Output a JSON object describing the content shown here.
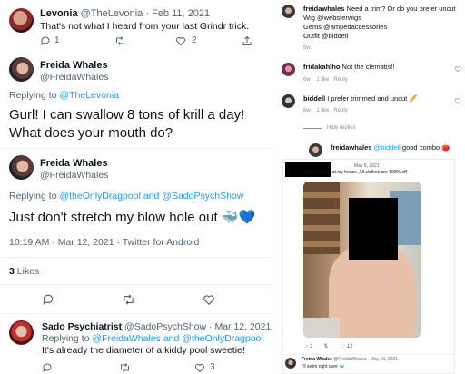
{
  "tweet1": {
    "name": "Levonia",
    "handle": "@TheLevonia",
    "dot": "·",
    "date": "Feb 11, 2021",
    "text": "That's not what I heard from your last Grindr trick.",
    "likes": "2"
  },
  "tweet2": {
    "name": "Freida Whales",
    "handle": "@FreidaWhales",
    "replying_prefix": "Replying to",
    "replying_to": "@TheLevonia",
    "text": "Gurl! I can swallow 8 tons of krill a day! What does your mouth do?"
  },
  "tweet3": {
    "name": "Freida Whales",
    "handle": "@FreidaWhales",
    "replying_prefix": "Replying to",
    "replying_to_1": "@theOnlyDragpool",
    "and": "and",
    "replying_to_2": "@SadoPsychShow",
    "text": "Just don't stretch my blow hole out",
    "emoji": "🐳💙",
    "time": "10:19 AM · Mar 12, 2021 · Twitter for Android",
    "likes_count": "3",
    "likes_label": "Likes"
  },
  "tweet4": {
    "name": "Sado Psychiatrist",
    "handle": "@SadoPsychShow",
    "dot": "·",
    "date": "Mar 12, 2021",
    "replying_prefix": "Replying to",
    "replying_to_1": "@FreidaWhales",
    "and": "and",
    "replying_to_2": "@theOnlyDragpool",
    "text": "It's already the diameter of a kiddy pool sweetie!",
    "likes": "3"
  },
  "instagram": {
    "c1_user": "freidawhales",
    "c1_text": "Need a trim? Or do you prefer uncut",
    "c1_line2": "Wig @websterwigs",
    "c1_line3": "Gems @ampedaccessories",
    "c1_line4": "Outfit @biddell",
    "c1_age": "6w",
    "c2_user": "fridakahlho",
    "c2_text": "Not the clematis!!",
    "c2_age": "6w",
    "c2_likes": "1 like",
    "c2_reply": "Reply",
    "c3_user": "biddell",
    "c3_text": "I prefer trimmed and uncut",
    "c3_emoji": "🥖",
    "c3_age": "6w",
    "c3_likes": "1 like",
    "c3_reply": "Reply",
    "hide_replies": "Hide replies",
    "c4_user": "freidawhales",
    "c4_mention": "@biddell",
    "c4_text": "good combo",
    "c4_emoji": "🍅"
  },
  "screenshot": {
    "date": "May 8, 2021",
    "text": "Having a sale at my house. All clothes are 100% off.",
    "retweets": "1",
    "likes": "12",
    "reply_name": "Freida Whales",
    "reply_handle": "@FreidaWhales · May 10, 2021",
    "reply_text": "I'll swim right over 🐳"
  },
  "colors": {
    "link": "#1d9bf0",
    "muted": "#536471",
    "border": "#eff3f4"
  }
}
